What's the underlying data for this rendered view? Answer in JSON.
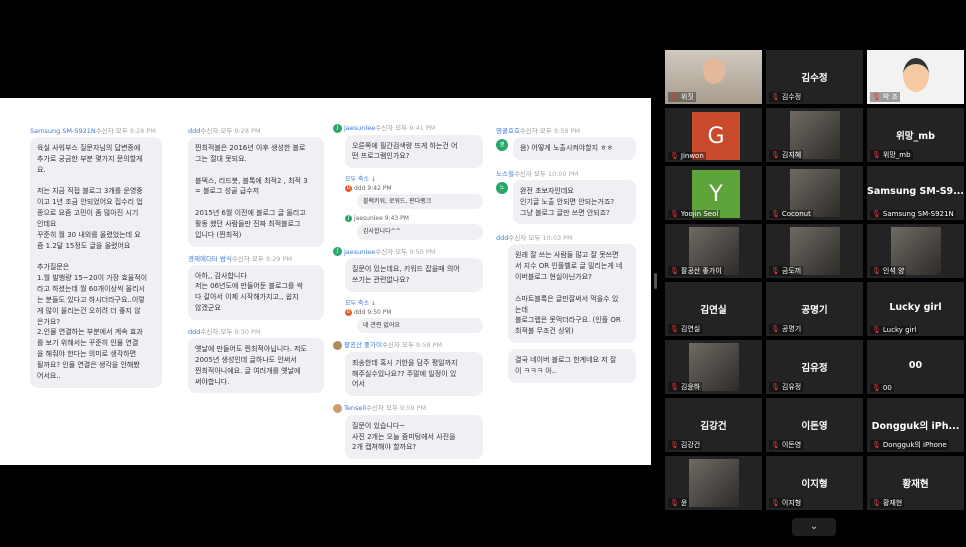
{
  "shared_screen": {
    "col1": [
      {
        "sender": "Samsung SM-S921N",
        "sub": "수신자 모두",
        "time": "9:28 PM",
        "text": "육실 사워부스 질문자님의 답변중에\n추가로 궁금한 부분 몇가지 문의할게\n요.\n\n저는 지금 직접 블로그 3개를 운영중\n이고 1년 조금 안되었어요 집수리 업\n종으로 요즘 고민이 좀 많아진 시기\n인데요\n꾸준히 월 30 내외를 올렸었는데 요\n즘 1.2달 15정도 글을 올렸어요\n\n추가질문은\n1.월 발행량 15~20이 가장 효율적이\n라고 하셨는데 월 60개이상씩 올리시\n는 분들도 있다고 하시더라구요..이렇\n게 많이 올리는건 오히려 더 좋지 않\n은가요?\n2.인물 연결하는 부분에서 계속 효과\n를 보기 위해서는 꾸준히 인물 연결\n을 해줘야 한다는 의미로 생각하면\n될까요? 인물 연결은 생각을 안해봤\n어서요.."
      }
    ],
    "col2": [
      {
        "sender": "ddd",
        "sub": "수신자 모두",
        "time": "9:28 PM",
        "text": "찐최적블은 2016년 이후 생성한 블로\n그는 절대 못되요.\n\n블덱스, 리드봇, 블톡에 최적2 , 최적 3\n= 블로그 성골 급수저\n\n2015년 6월 이전에 블로그 글 올리고\n활동 했던 사람들만 진짜 최적블로그\n입니다 (찐최적)"
      },
      {
        "sender": "경제에디터 밤식",
        "sub": "수신자 모두",
        "time": "9:29 PM",
        "text": "아하,, 감사합니다\n저는 06년도에 만들어둔 블로그를 싹\n다 갈아서 이제 시작해가지고,, 쉽지\n않겠군요"
      },
      {
        "sender": "ddd",
        "sub": "수신자 모두",
        "time": "9:30 PM",
        "text": "옛날에 만들어도 찐최적아닙니다. 저도\n2005년 생성인데 글하나도 안써서\n찐최적아니에요. 글 여러개를 옛날에\n써야합니다."
      }
    ],
    "col3": {
      "m1_sender": "jaesunlee",
      "m1_sub": "수신자 모두",
      "m1_time": "9:41 PM",
      "m1_text": "오른쪽에 필간검색량 뜨게 하는건 어\n떤 프로그램인가요?",
      "m1_reply": "모두 축소 ↓",
      "r1_sender": "ddd",
      "r1_time": "9:42 PM",
      "r1_text": "블랙키워, 로워드, 판다랭크",
      "r2_sender": "jaesunlee",
      "r2_time": "9:43 PM",
      "r2_text": "감사합니다^^",
      "m2_sender": "jaesunlee",
      "m2_sub": "수신자 모두",
      "m2_time": "9:50 PM",
      "m2_text": "질문이 있는데요, 키워드 잡을때 의어\n쓰기는 관련없나요?",
      "m2_reply": "모두 축소 ↓",
      "r3_sender": "ddd",
      "r3_time": "9:50 PM",
      "r3_text": "네 관련 없어요",
      "m3_sender": "팔공산 좋가이",
      "m3_sub": "수신자 모두",
      "m3_time": "9:58 PM",
      "m3_text": "죄송한데 혹시 기한을 담주 평일까지\n해주실수있나요?? 주말에 일정이 있\n어서",
      "m4_sender": "Tenseil",
      "m4_sub": "수신자 모두",
      "m4_time": "9:59 PM",
      "m4_text": "질문이 있습니다~\n사진 2개는 오늘 줌미팅에서 사진을\n2개 캡쳐해야 할까요?"
    },
    "col4": [
      {
        "sender": "영콜호호",
        "sub": "수신자 모두",
        "time": "9:59 PM",
        "avatar": "영",
        "text": "음) 어떻게 노출시켜야할지 ㅎㅎ"
      },
      {
        "sender": "노스힐",
        "sub": "수신자 모두",
        "time": "10:00 PM",
        "avatar": "노",
        "text": "완전 초보자인데요\n인기글 노출 안되면 안되는거죠?\n그냥 블로그 글만 쓰면 안되죠?"
      },
      {
        "sender": "ddd",
        "sub": "수신자 모두",
        "time": "10:03 PM",
        "avatar": "",
        "text": "원래 잘 쓰는 사람들 많고 잘 못쓰면\n서 지수 OR 인플벨로 글 밀리는게 네\n이버블로그 현실아닌가요?\n\n스마트블록은 글만잘써서 먹을수 있\n는데\n블로그랩은 못먹더라구요. (인플 OR\n최적블 무조건 상위)"
      },
      {
        "sender": "",
        "sub": "",
        "time": "",
        "avatar": "",
        "text": "결국 네이버 블로그 한계네요 저 잘\n이 ㅋㅋㅋ 아.."
      }
    ]
  },
  "participants": [
    {
      "name": "",
      "label": "위짓",
      "type": "video"
    },
    {
      "name": "김수정",
      "label": "김수정",
      "type": "name"
    },
    {
      "name": "",
      "label": "박 조",
      "type": "avatar"
    },
    {
      "name": "",
      "label": "Jinwon",
      "type": "letter",
      "letter": "G",
      "color": "#c94a2c"
    },
    {
      "name": "",
      "label": "김지혜",
      "type": "img"
    },
    {
      "name": "위망_mb",
      "label": "위망_mb",
      "type": "name"
    },
    {
      "name": "",
      "label": "Yoojin Seol",
      "type": "letter",
      "letter": "Y",
      "color": "#5ea43b"
    },
    {
      "name": "",
      "label": "Coconut",
      "type": "img"
    },
    {
      "name": "Samsung  SM-S9...",
      "label": "Samsung SM-S921N",
      "type": "name"
    },
    {
      "name": "",
      "label": "팔공산 좋가이",
      "type": "img"
    },
    {
      "name": "",
      "label": "금도끼",
      "type": "img"
    },
    {
      "name": "",
      "label": "인석 양",
      "type": "img"
    },
    {
      "name": "김연실",
      "label": "김연실",
      "type": "name"
    },
    {
      "name": "공명기",
      "label": "공명기",
      "type": "name"
    },
    {
      "name": "Lucky girl",
      "label": "Lucky girl",
      "type": "name"
    },
    {
      "name": "",
      "label": "김윤하",
      "type": "img"
    },
    {
      "name": "김유정",
      "label": "김유정",
      "type": "name"
    },
    {
      "name": "00",
      "label": "00",
      "type": "name"
    },
    {
      "name": "김강건",
      "label": "김강건",
      "type": "name"
    },
    {
      "name": "이돈영",
      "label": "이돈영",
      "type": "name"
    },
    {
      "name": "Dongguk의 iPh...",
      "label": "Dongguk의 iPhone",
      "type": "name"
    },
    {
      "name": "",
      "label": "윤",
      "type": "img"
    },
    {
      "name": "이지형",
      "label": "이지형",
      "type": "name"
    },
    {
      "name": "황재현",
      "label": "황재현",
      "type": "name"
    }
  ],
  "nav": {
    "expand_label": "⌄"
  }
}
